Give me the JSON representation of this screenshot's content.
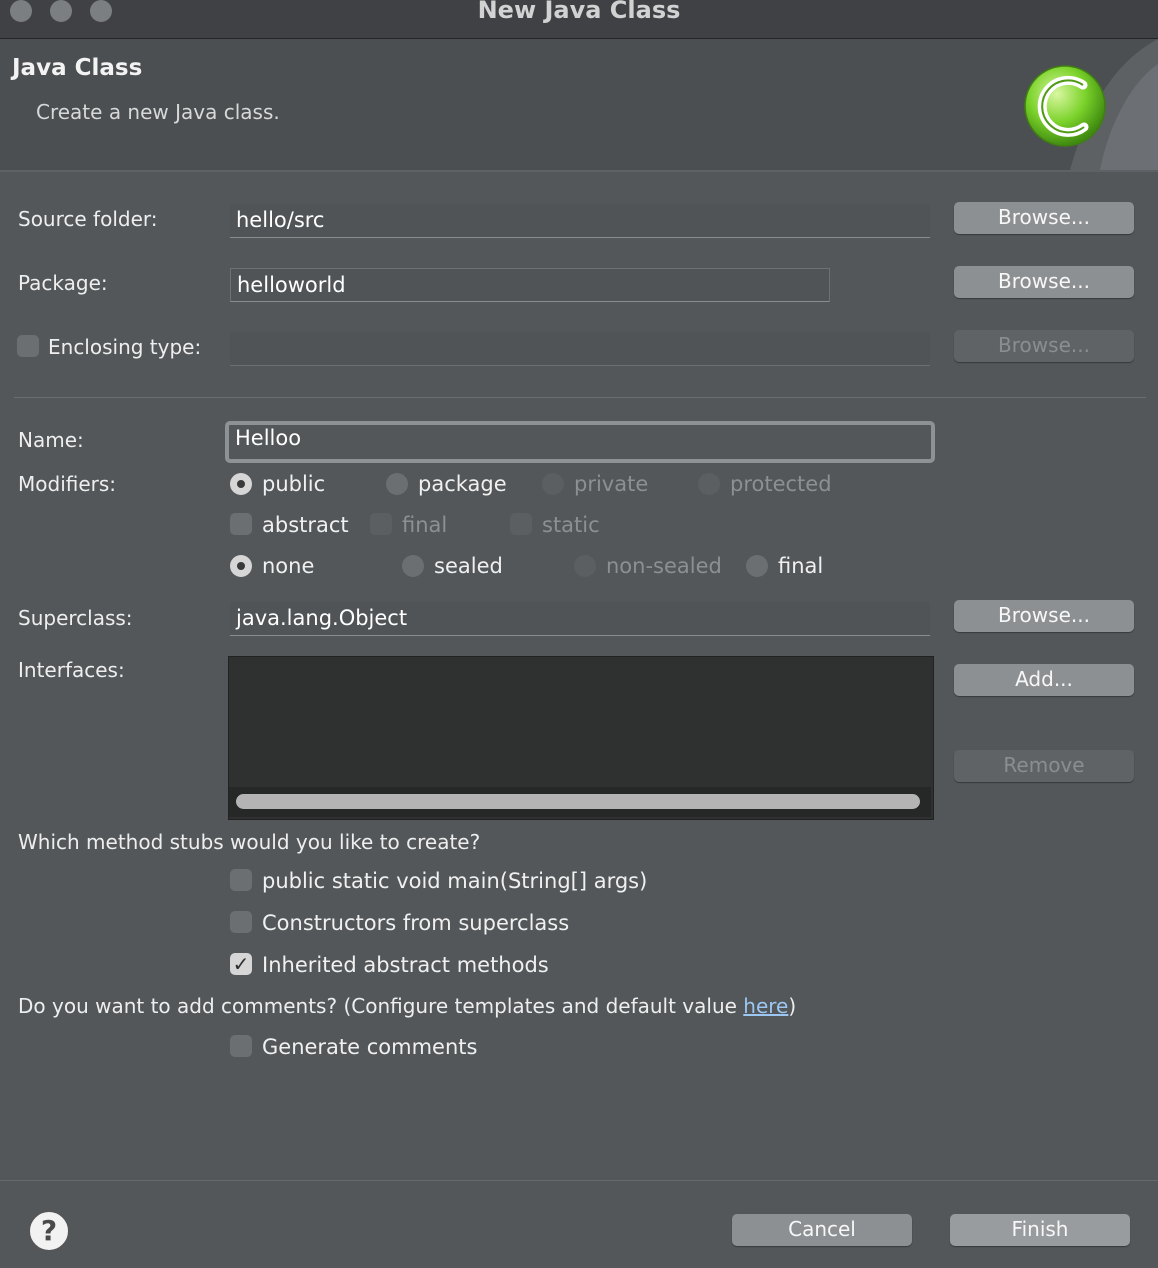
{
  "window": {
    "title": "New Java Class"
  },
  "header": {
    "title": "Java Class",
    "subtitle": "Create a new Java class."
  },
  "source_folder": {
    "label": "Source folder:",
    "value": "hello/src",
    "browse": "Browse..."
  },
  "package": {
    "label": "Package:",
    "value": "helloworld",
    "browse": "Browse..."
  },
  "enclosing": {
    "label": "Enclosing type:",
    "value": "",
    "browse": "Browse..."
  },
  "name": {
    "label": "Name:",
    "value": "Helloo"
  },
  "modifiers": {
    "label": "Modifiers:",
    "access": [
      "public",
      "package",
      "private",
      "protected"
    ],
    "flags": [
      "abstract",
      "final",
      "static"
    ],
    "sealing": [
      "none",
      "sealed",
      "non-sealed",
      "final"
    ]
  },
  "superclass": {
    "label": "Superclass:",
    "value": "java.lang.Object",
    "browse": "Browse..."
  },
  "interfaces": {
    "label": "Interfaces:",
    "add": "Add...",
    "remove": "Remove"
  },
  "stubs": {
    "question": "Which method stubs would you like to create?",
    "main": "public static void main(String[] args)",
    "constructors": "Constructors from superclass",
    "inherited": "Inherited abstract methods"
  },
  "comments": {
    "question_prefix": "Do you want to add comments? (Configure templates and default value ",
    "link": "here",
    "question_suffix": ")",
    "generate": "Generate comments"
  },
  "footer": {
    "help": "?",
    "cancel": "Cancel",
    "finish": "Finish"
  },
  "colors": {
    "background": "#53575a",
    "header": "#4b4f52",
    "button": "#8d9093",
    "link": "#9cc7f3",
    "logo_green": "#7bd22a"
  }
}
